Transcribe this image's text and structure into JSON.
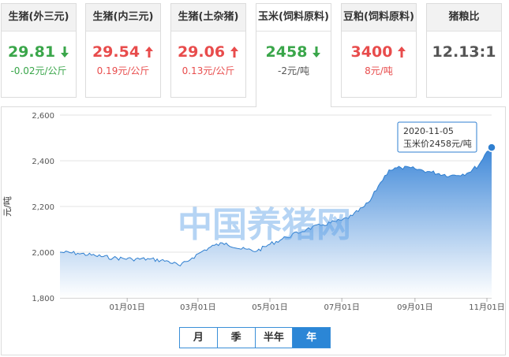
{
  "cards": [
    {
      "name": "生猪(外三元)",
      "price": "29.81",
      "change": "-0.02元/公斤",
      "direction": "down"
    },
    {
      "name": "生猪(内三元)",
      "price": "29.54",
      "change": "0.19元/公斤",
      "direction": "up"
    },
    {
      "name": "生猪(土杂猪)",
      "price": "29.06",
      "change": "0.13元/公斤",
      "direction": "up"
    },
    {
      "name": "玉米(饲料原料)",
      "price": "2458",
      "change": "-2元/吨",
      "direction": "down"
    },
    {
      "name": "豆粕(饲料原料)",
      "price": "3400",
      "change": "8元/吨",
      "direction": "up"
    },
    {
      "name": "猪粮比",
      "price": "12.13:1",
      "change": "",
      "direction": "none"
    }
  ],
  "tabs": [
    {
      "label": "月",
      "active": false
    },
    {
      "label": "季",
      "active": false
    },
    {
      "label": "半年",
      "active": false
    },
    {
      "label": "年",
      "active": true
    }
  ],
  "watermark": "中国养猪网",
  "tooltip": {
    "date": "2020-11-05",
    "text": "玉米价2458元/吨"
  },
  "colors": {
    "up": "#e84c4c",
    "down": "#3aa64a",
    "accent": "#2b86d6",
    "area_top": "#3d87d8",
    "area_bottom": "#ffffff"
  },
  "chart_data": {
    "type": "area",
    "title": "",
    "xlabel": "",
    "ylabel": "元/吨",
    "ylim": [
      1800,
      2600
    ],
    "yticks": [
      1800,
      2000,
      2200,
      2400,
      2600
    ],
    "yticklabels": [
      "1,800",
      "2,000",
      "2,200",
      "2,400",
      "2,600"
    ],
    "xticks": [
      "2020-01-01",
      "2020-03-01",
      "2020-05-01",
      "2020-07-01",
      "2020-09-01",
      "2020-11-01"
    ],
    "xticklabels": [
      "01月01日",
      "03月01日",
      "05月01日",
      "07月01日",
      "09月01日",
      "11月01日"
    ],
    "xlim": [
      "2019-11-05",
      "2020-11-05"
    ],
    "grid": true,
    "series": [
      {
        "values": [
          {
            "x": "2019-11-05",
            "y": 2000
          },
          {
            "x": "2019-11-20",
            "y": 1995
          },
          {
            "x": "2019-12-05",
            "y": 1985
          },
          {
            "x": "2019-12-20",
            "y": 1975
          },
          {
            "x": "2020-01-05",
            "y": 1970
          },
          {
            "x": "2020-01-20",
            "y": 1970
          },
          {
            "x": "2020-02-05",
            "y": 1960
          },
          {
            "x": "2020-02-15",
            "y": 1940
          },
          {
            "x": "2020-02-25",
            "y": 1975
          },
          {
            "x": "2020-03-05",
            "y": 2005
          },
          {
            "x": "2020-03-15",
            "y": 2030
          },
          {
            "x": "2020-03-25",
            "y": 2040
          },
          {
            "x": "2020-04-05",
            "y": 2015
          },
          {
            "x": "2020-04-20",
            "y": 2005
          },
          {
            "x": "2020-05-01",
            "y": 2035
          },
          {
            "x": "2020-05-15",
            "y": 2065
          },
          {
            "x": "2020-06-01",
            "y": 2100
          },
          {
            "x": "2020-06-15",
            "y": 2120
          },
          {
            "x": "2020-07-01",
            "y": 2140
          },
          {
            "x": "2020-07-10",
            "y": 2160
          },
          {
            "x": "2020-07-20",
            "y": 2200
          },
          {
            "x": "2020-07-25",
            "y": 2225
          },
          {
            "x": "2020-08-01",
            "y": 2290
          },
          {
            "x": "2020-08-10",
            "y": 2360
          },
          {
            "x": "2020-08-20",
            "y": 2370
          },
          {
            "x": "2020-09-01",
            "y": 2365
          },
          {
            "x": "2020-09-15",
            "y": 2350
          },
          {
            "x": "2020-10-01",
            "y": 2335
          },
          {
            "x": "2020-10-15",
            "y": 2345
          },
          {
            "x": "2020-10-25",
            "y": 2380
          },
          {
            "x": "2020-11-01",
            "y": 2440
          },
          {
            "x": "2020-11-05",
            "y": 2458
          }
        ]
      }
    ]
  }
}
